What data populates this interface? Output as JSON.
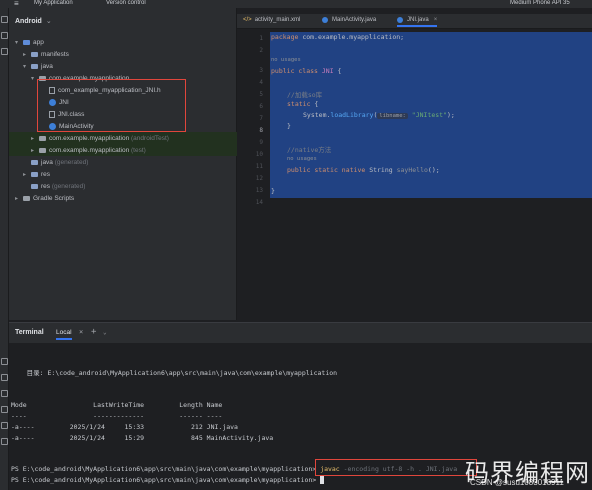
{
  "topbar": {
    "menu_icon": "≡",
    "project": "My Application",
    "version_control": "Version control",
    "device": "Medium Phone API 35"
  },
  "project_panel": {
    "title": "Android",
    "tree": [
      {
        "label": "app",
        "sub": ""
      },
      {
        "label": "manifests",
        "sub": ""
      },
      {
        "label": "java",
        "sub": ""
      },
      {
        "label": "com.example.myapplication",
        "sub": ""
      },
      {
        "label": "com_example_myapplication_JNI.h",
        "sub": ""
      },
      {
        "label": "JNI",
        "sub": ""
      },
      {
        "label": "JNI.class",
        "sub": ""
      },
      {
        "label": "MainActivity",
        "sub": ""
      },
      {
        "label": "com.example.myapplication",
        "sub": "(androidTest)"
      },
      {
        "label": "com.example.myapplication",
        "sub": "(test)"
      },
      {
        "label": "java",
        "sub": "(generated)"
      },
      {
        "label": "res",
        "sub": ""
      },
      {
        "label": "res",
        "sub": "(generated)"
      },
      {
        "label": "Gradle Scripts",
        "sub": ""
      }
    ]
  },
  "editor": {
    "tabs": [
      {
        "label": "activity_main.xml"
      },
      {
        "label": "MainActivity.java"
      },
      {
        "label": "JNI.java"
      }
    ],
    "line_numbers": [
      "1",
      "2",
      "3",
      "4",
      "5",
      "6",
      "7",
      "8",
      "9",
      "10",
      "11",
      "12",
      "13",
      "14"
    ],
    "code": {
      "l1_kw": "package",
      "l1_rest": " com.example.myapplication;",
      "usages1": "no usages",
      "l3_kw": "public class",
      "l3_name": " JNI",
      "l3_brace": " {",
      "l4_comment": "//加载so库",
      "l5_kw": "static",
      "l5_brace": " {",
      "l6_a": "System.",
      "l6_fn": "loadLibrary",
      "l6_b": "(",
      "l6_hint": "libname:",
      "l6_str": " \"JNItest\"",
      "l6_c": ");",
      "l7": "}",
      "l9_comment": "//native方法",
      "usages2": "no usages",
      "l10_kw": "public static native",
      "l10_type": " String",
      "l10_fn": " sayHello",
      "l10_end": "();",
      "l12": "}"
    }
  },
  "terminal": {
    "title": "Terminal",
    "tab": "Local",
    "close": "×",
    "add": "+",
    "dropdown": "⌄",
    "dir_line": "    目录: E:\\code_android\\MyApplication6\\app\\src\\main\\java\\com\\example\\myapplication",
    "header": "Mode                 LastWriteTime         Length Name",
    "divider": "----                 -------------         ------ ----",
    "rows": [
      "-a----         2025/1/24     15:33            212 JNI.java",
      "-a----         2025/1/24     15:29            845 MainActivity.java"
    ],
    "prompt1": "PS E:\\code_android\\MyApplication6\\app\\src\\main\\java\\com\\example\\myapplication> ",
    "cmd_javac": "javac",
    "cmd_args": " -encoding utf-8 -h . JNI.java",
    "prompt2": "PS E:\\code_android\\MyApplication6\\app\\src\\main\\java\\com\\example\\myapplication> "
  },
  "watermark": {
    "big": "码界编程网",
    "small": "CSDN @susu1083018911"
  },
  "colors": {
    "selection": "#214283",
    "highlight_box": "#e0463c",
    "keyword": "#cf8e6d",
    "string": "#6aab73"
  }
}
